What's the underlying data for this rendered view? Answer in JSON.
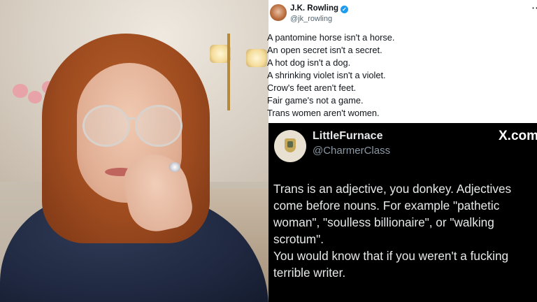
{
  "tweet": {
    "author_name": "J.K. Rowling",
    "handle": "@jk_rowling",
    "verified_icon": "verified-badge-icon",
    "more_icon": "more-options-icon",
    "more_glyph": "⋯",
    "lines": [
      "A pantomine horse isn't a horse.",
      "An open secret isn't a secret.",
      "A hot dog isn't a dog.",
      "A shrinking violet isn't a violet.",
      "Crow's feet aren't feet.",
      "Fair game's not a game.",
      "Trans women aren't women."
    ]
  },
  "reply": {
    "author_name": "LittleFurnace",
    "handle": "@CharmerClass",
    "watermark": "X.com",
    "body_lines": [
      "Trans is an adjective, you donkey. Adjectives",
      "come before nouns. For example \"pathetic",
      "woman\", \"soulless billionaire\", or \"walking",
      "scrotum\".",
      "You would know that if you weren't a fucking",
      "terrible writer."
    ]
  },
  "colors": {
    "verified": "#1d9bf0",
    "reply_background": "#000000",
    "tweet_background": "#ffffff",
    "secondary_text": "#536471"
  }
}
